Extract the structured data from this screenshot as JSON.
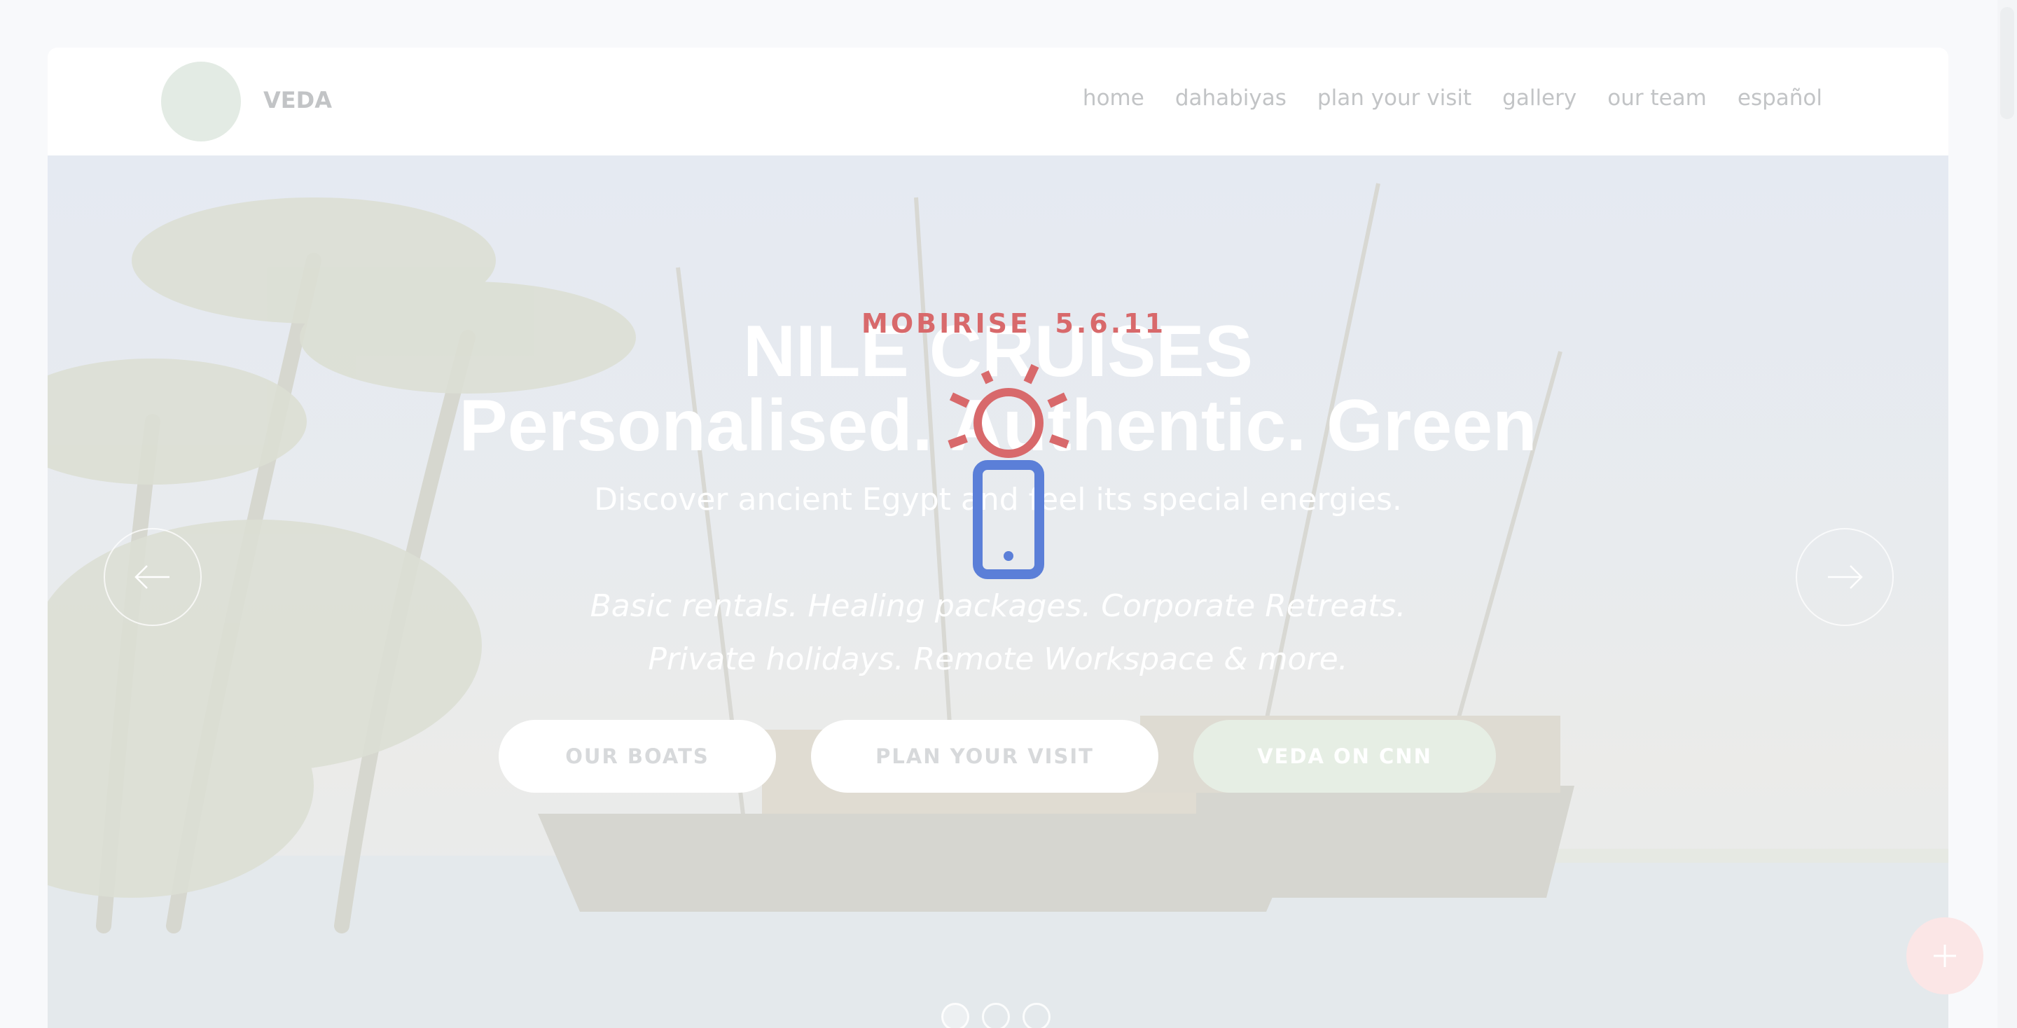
{
  "brand": {
    "name": "VEDA"
  },
  "nav": {
    "items": [
      "home",
      "dahabiyas",
      "plan your visit",
      "gallery",
      "our team",
      "español"
    ]
  },
  "hero": {
    "title_line1": "NILE CRUISES",
    "title_line2": "Personalised. Authentic. Green",
    "subtitle": "Discover ancient Egypt and feel its special energies.",
    "tagline_line1": "Basic rentals. Healing packages. Corporate Retreats.",
    "tagline_line2": "Private holidays. Remote Workspace & more.",
    "buttons": {
      "our_boats": "OUR BOATS",
      "plan_visit": "PLAN YOUR VISIT",
      "veda_cnn": "VEDA ON CNN"
    },
    "slides": {
      "count": 3,
      "active": 1
    }
  },
  "overlay": {
    "label": "MOBIRISE",
    "version": "5.6.11"
  },
  "colors": {
    "overlay_red": "#d8696b",
    "overlay_blue": "#5b7fd8",
    "button_green": "#e6eee4",
    "fab_pink": "#fbe6e6"
  },
  "icons": {
    "prev": "arrow-left-icon",
    "next": "arrow-right-icon",
    "fab": "plus-icon",
    "overlay": "sun-phone-icon"
  }
}
